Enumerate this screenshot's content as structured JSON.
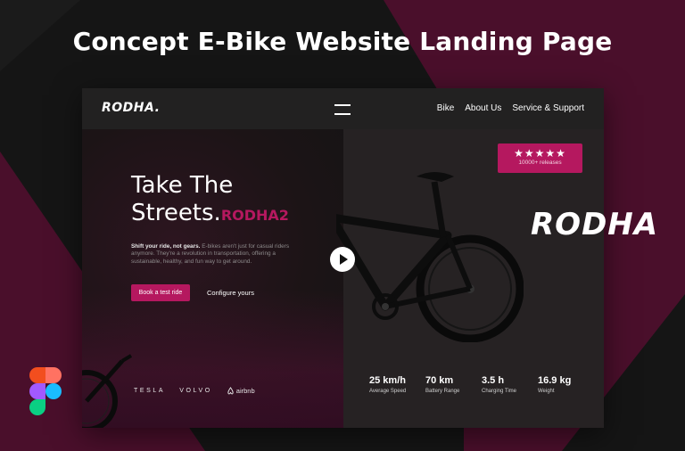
{
  "page_title": "Concept E-Bike Website Landing Page",
  "nav": {
    "logo": "RODHA.",
    "links": [
      "Bike",
      "About Us",
      "Service & Support"
    ]
  },
  "hero": {
    "title_line1": "Take The",
    "title_line2": "Streets.",
    "title_accent": "RODHA2",
    "desc_bold": "Shift your ride, not gears.",
    "desc_rest": " E-bikes aren't just for casual riders anymore. They're a revolution in transportation, offering a sustainable, healthy, and fun way to get around.",
    "primary_cta": "Book a test ride",
    "secondary_cta": "Configure yours"
  },
  "brands": [
    "TESLA",
    "VOLVO",
    "airbnb"
  ],
  "rating": {
    "stars": 5,
    "label": "10000+ releases"
  },
  "stats": [
    {
      "value": "25 km/h",
      "label": "Average Speed"
    },
    {
      "value": "70 km",
      "label": "Battery Range"
    },
    {
      "value": "3.5 h",
      "label": "Charging Time"
    },
    {
      "value": "16.9 kg",
      "label": "Weight"
    }
  ],
  "brand_mark": "RODHA",
  "colors": {
    "accent": "#b5185f",
    "maroon_bg": "#4a0f2b",
    "dark_bg": "#151515"
  },
  "icons": [
    "hamburger-icon",
    "play-icon",
    "star-icon",
    "airbnb-icon",
    "figma-icon"
  ]
}
